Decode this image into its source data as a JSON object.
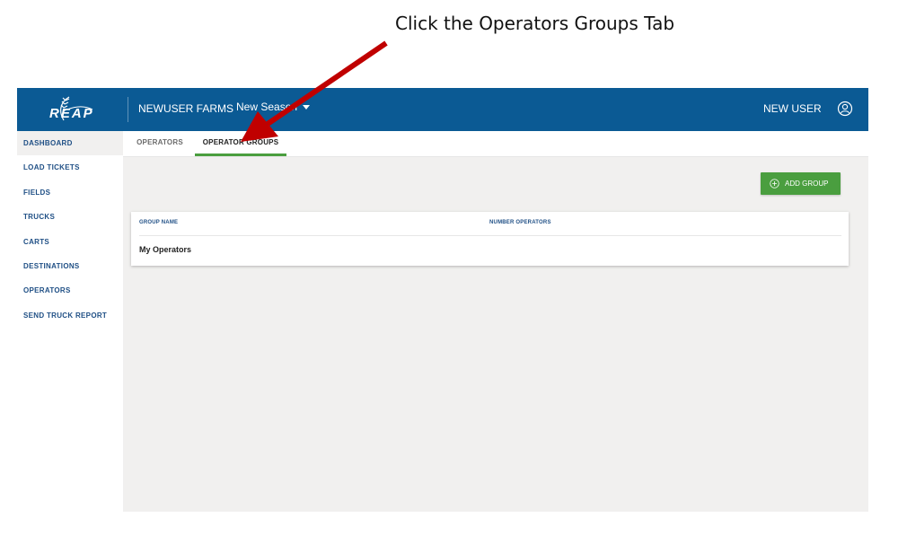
{
  "annotation": {
    "text": "Click the Operators Groups Tab",
    "arrow_color": "#c00000"
  },
  "header": {
    "logo_text": "REAP",
    "farm": "NEWUSER FARMS",
    "season": "New Season",
    "user": "NEW USER",
    "bg_color": "#0b5a94"
  },
  "sidebar": {
    "items": [
      {
        "label": "DASHBOARD",
        "active": true
      },
      {
        "label": "LOAD TICKETS"
      },
      {
        "label": "FIELDS"
      },
      {
        "label": "TRUCKS"
      },
      {
        "label": "CARTS"
      },
      {
        "label": "DESTINATIONS"
      },
      {
        "label": "OPERATORS"
      },
      {
        "label": "SEND TRUCK REPORT"
      }
    ]
  },
  "tabs": [
    {
      "label": "OPERATORS"
    },
    {
      "label": "OPERATOR GROUPS",
      "active": true
    }
  ],
  "actions": {
    "add_group": "ADD GROUP",
    "add_color": "#4a9e3f"
  },
  "table": {
    "columns": [
      "GROUP NAME",
      "NUMBER OPERATORS"
    ],
    "rows": [
      {
        "name": "My Operators",
        "count": ""
      }
    ]
  }
}
